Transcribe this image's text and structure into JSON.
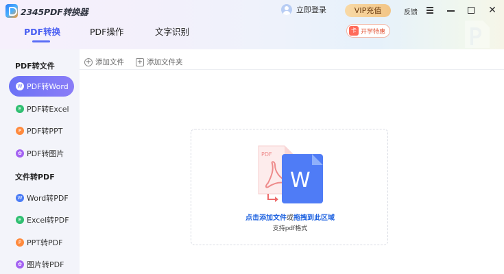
{
  "app": {
    "title": "2345PDF转换器",
    "login_label": "立即登录",
    "vip_label": "VIP充值",
    "feedback_label": "反馈",
    "close_glyph": "✕"
  },
  "tabs": [
    {
      "label": "PDF转换",
      "active": true
    },
    {
      "label": "PDF操作",
      "active": false
    },
    {
      "label": "文字识别",
      "active": false
    }
  ],
  "promo": {
    "label": "开学特惠",
    "icon_glyph": "卡"
  },
  "sidebar": {
    "sections": [
      {
        "title": "PDF转文件",
        "items": [
          {
            "label": "PDF转Word",
            "icon": "word-icon",
            "icon_glyph": "W",
            "color": "#4a7cf6",
            "active": true
          },
          {
            "label": "PDF转Excel",
            "icon": "excel-icon",
            "icon_glyph": "E",
            "color": "#2fbf71",
            "active": false
          },
          {
            "label": "PDF转PPT",
            "icon": "ppt-icon",
            "icon_glyph": "P",
            "color": "#ff8a3d",
            "active": false
          },
          {
            "label": "PDF转图片",
            "icon": "image-icon",
            "icon_glyph": "✿",
            "color": "#a463f2",
            "active": false
          }
        ]
      },
      {
        "title": "文件转PDF",
        "items": [
          {
            "label": "Word转PDF",
            "icon": "word-icon",
            "icon_glyph": "W",
            "color": "#4a7cf6",
            "active": false
          },
          {
            "label": "Excel转PDF",
            "icon": "excel-icon",
            "icon_glyph": "E",
            "color": "#2fbf71",
            "active": false
          },
          {
            "label": "PPT转PDF",
            "icon": "ppt-icon",
            "icon_glyph": "P",
            "color": "#ff8a3d",
            "active": false
          },
          {
            "label": "图片转PDF",
            "icon": "image-icon",
            "icon_glyph": "✿",
            "color": "#a463f2",
            "active": false
          }
        ]
      }
    ]
  },
  "toolbar": {
    "add_file_label": "添加文件",
    "add_folder_label": "添加文件夹",
    "add_icon_glyph": "+"
  },
  "dropzone": {
    "text_click_add": "点击添加文件",
    "text_or": "或",
    "text_drag": "拖拽到此区域",
    "sub_text": "支持pdf格式",
    "illus_pdf_label": "PDF",
    "illus_word_label": "W"
  },
  "colors": {
    "accent": "#4a5ff2",
    "active_item_gradient_start": "#6b72f6",
    "active_item_gradient_end": "#8a7df7",
    "vip_bg": "#f5cf96",
    "link_blue": "#1f63e0"
  }
}
